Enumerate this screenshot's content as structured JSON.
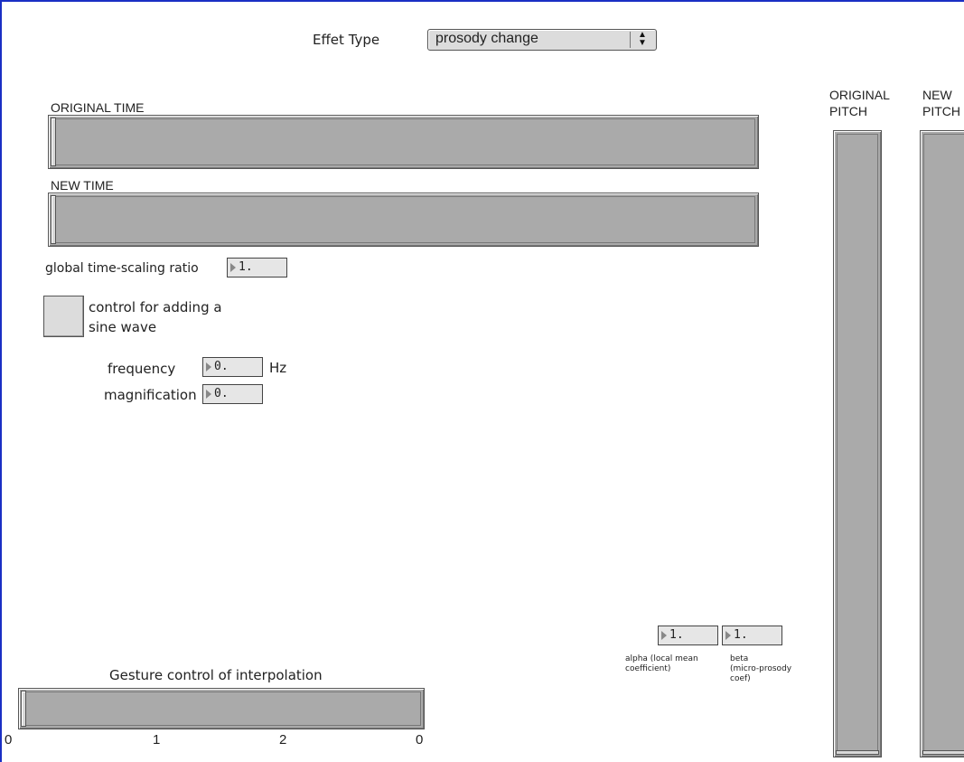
{
  "header": {
    "effect_type_label": "Effet Type",
    "effect_type_value": "prosody change",
    "dropdown_arrows": "◆"
  },
  "time_sliders": {
    "original_label": "ORIGINAL TIME",
    "new_label": "NEW TIME",
    "original_value_fraction": 0.0,
    "new_value_fraction": 0.0
  },
  "global_time": {
    "label": "global time-scaling ratio",
    "value": "1."
  },
  "sine_control": {
    "label_line1": "control for adding a",
    "label_line2": "sine wave",
    "frequency_label": "frequency",
    "frequency_value": "0.",
    "frequency_unit": "Hz",
    "magnification_label": "magnification",
    "magnification_value": "0."
  },
  "pitch": {
    "original_label_line1": "ORIGINAL",
    "original_label_line2": "PITCH",
    "new_label_line1": "NEW",
    "new_label_line2": "PITCH",
    "original_value_fraction": 0.0,
    "new_value_fraction": 0.0
  },
  "coefficients": {
    "alpha_value": "1.",
    "beta_value": "1.",
    "alpha_label_line1": "alpha (local mean",
    "alpha_label_line2": "coefficient)",
    "beta_label_line1": "beta",
    "beta_label_line2": "(micro-prosody",
    "beta_label_line3": "coef)"
  },
  "gesture": {
    "label": "Gesture control of interpolation",
    "value_fraction": 0.0,
    "ticks": [
      "0",
      "1",
      "2",
      "0"
    ]
  },
  "colors": {
    "patch_border": "#1a2fc4",
    "slider_fill": "#aaaaaa",
    "widget_bg": "#dcdcdc"
  }
}
